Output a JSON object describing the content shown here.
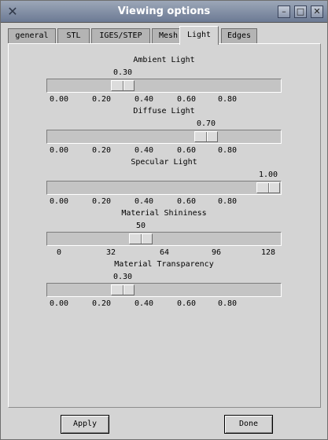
{
  "window": {
    "title": "Viewing options"
  },
  "tabs": [
    {
      "label": "general",
      "active": false
    },
    {
      "label": "STL",
      "active": false
    },
    {
      "label": "IGES/STEP",
      "active": false
    },
    {
      "label": "Mesh",
      "active": false
    },
    {
      "label": "Light",
      "active": true
    },
    {
      "label": "Edges",
      "active": false
    }
  ],
  "sliders": [
    {
      "label": "Ambient Light",
      "value": "0.30",
      "level": 0.3,
      "ticks": [
        "0.00",
        "0.20",
        "0.40",
        "0.60",
        "0.80"
      ]
    },
    {
      "label": "Diffuse Light",
      "value": "0.70",
      "level": 0.7,
      "ticks": [
        "0.00",
        "0.20",
        "0.40",
        "0.60",
        "0.80"
      ]
    },
    {
      "label": "Specular Light",
      "value": "1.00",
      "level": 1.0,
      "ticks": [
        "0.00",
        "0.20",
        "0.40",
        "0.60",
        "0.80"
      ]
    },
    {
      "label": "Material Shininess",
      "value": "50",
      "level": 0.39,
      "ticks": [
        "0",
        "32",
        "64",
        "96",
        "128"
      ]
    },
    {
      "label": "Material Transparency",
      "value": "0.30",
      "level": 0.3,
      "ticks": [
        "0.00",
        "0.20",
        "0.40",
        "0.60",
        "0.80"
      ]
    }
  ],
  "buttons": {
    "apply": "Apply",
    "done": "Done"
  },
  "icons": {
    "app": "x-logo-icon",
    "minimize": "minimize-icon",
    "maximize": "maximize-icon",
    "close": "close-icon"
  }
}
